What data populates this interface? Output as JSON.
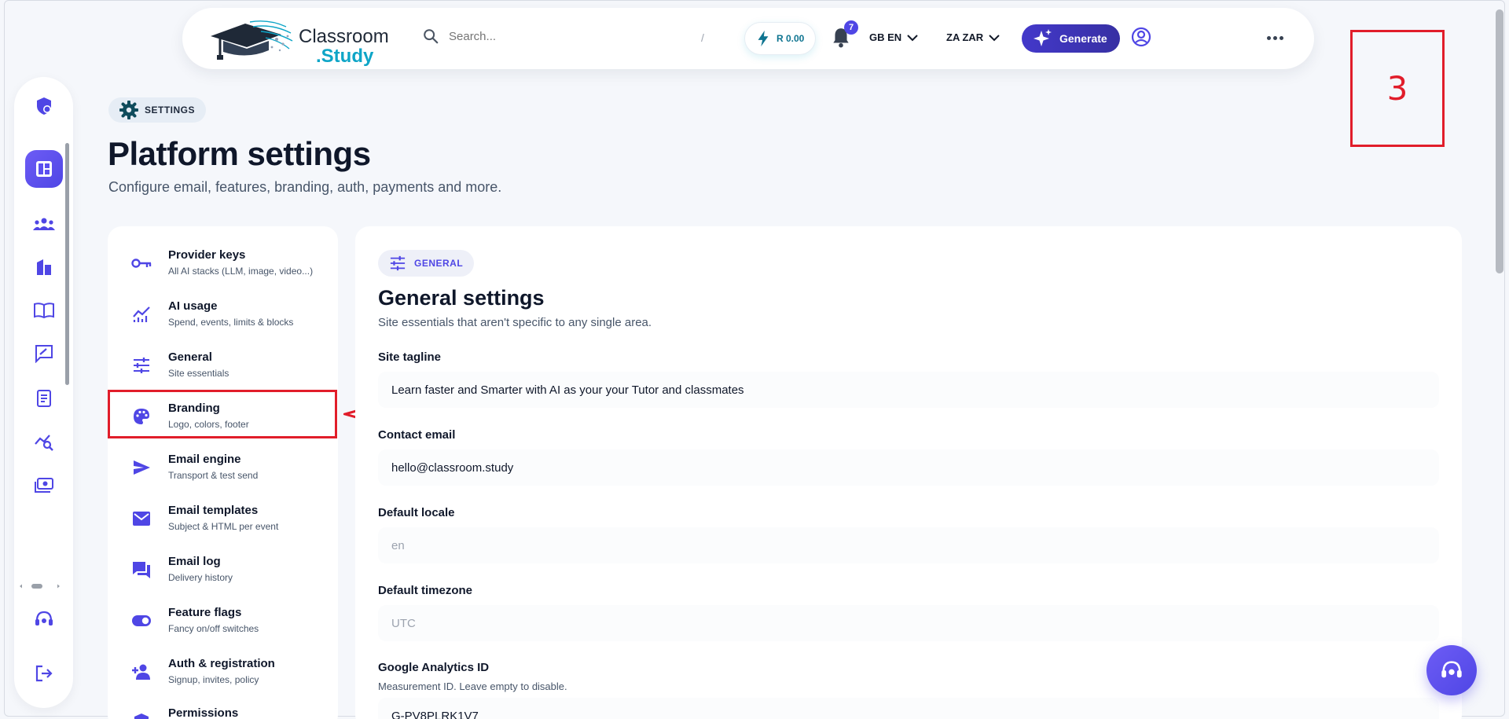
{
  "header": {
    "logo": {
      "line1": "Classroom",
      "line2": ".Study"
    },
    "search": {
      "placeholder": "Search...",
      "shortcut": "/"
    },
    "credit": "R 0.00",
    "notifications": {
      "count": "7"
    },
    "language": "GB EN",
    "currency": "ZA ZAR",
    "generate_label": "Generate",
    "accent": "#4338ca"
  },
  "annotation": {
    "step_number": "3",
    "color": "#e11d2a"
  },
  "rail": {
    "items": [
      {
        "icon": "shield-account-icon"
      },
      {
        "icon": "dashboard-icon",
        "active": true
      },
      {
        "icon": "groups-icon"
      },
      {
        "icon": "building-icon"
      },
      {
        "icon": "book-open-icon"
      },
      {
        "icon": "chat-edit-icon"
      },
      {
        "icon": "document-icon"
      },
      {
        "icon": "analytics-search-icon"
      },
      {
        "icon": "payments-icon"
      },
      {
        "icon": "support-icon"
      },
      {
        "icon": "logout-icon"
      }
    ]
  },
  "page": {
    "chip": "SETTINGS",
    "title": "Platform settings",
    "subtitle": "Configure email, features, branding, auth, payments and more."
  },
  "settings_nav": {
    "items": [
      {
        "title": "Provider keys",
        "subtitle": "All AI stacks (LLM, image, video...)",
        "icon": "key-icon"
      },
      {
        "title": "AI usage",
        "subtitle": "Spend, events, limits & blocks",
        "icon": "chart-line-icon"
      },
      {
        "title": "General",
        "subtitle": "Site essentials",
        "icon": "sliders-icon"
      },
      {
        "title": "Branding",
        "subtitle": "Logo, colors, footer",
        "icon": "palette-icon",
        "highlighted": true
      },
      {
        "title": "Email engine",
        "subtitle": "Transport & test send",
        "icon": "send-icon"
      },
      {
        "title": "Email templates",
        "subtitle": "Subject & HTML per event",
        "icon": "mail-icon"
      },
      {
        "title": "Email log",
        "subtitle": "Delivery history",
        "icon": "forum-icon"
      },
      {
        "title": "Feature flags",
        "subtitle": "Fancy on/off switches",
        "icon": "toggle-icon"
      },
      {
        "title": "Auth & registration",
        "subtitle": "Signup, invites, policy",
        "icon": "person-add-icon"
      },
      {
        "title": "Permissions",
        "subtitle": "",
        "icon": "shield-icon"
      }
    ]
  },
  "general": {
    "chip": "GENERAL",
    "title": "General settings",
    "subtitle": "Site essentials that aren't specific to any single area.",
    "fields": {
      "tagline": {
        "label": "Site tagline",
        "value": "Learn faster and Smarter with AI as your your Tutor and classmates"
      },
      "contact_email": {
        "label": "Contact email",
        "value": "hello@classroom.study"
      },
      "default_locale": {
        "label": "Default locale",
        "placeholder": "en"
      },
      "default_timezone": {
        "label": "Default timezone",
        "placeholder": "UTC"
      },
      "google_analytics": {
        "label": "Google Analytics ID",
        "help": "Measurement ID. Leave empty to disable.",
        "value": "G-PV8PLRK1V7"
      }
    }
  }
}
